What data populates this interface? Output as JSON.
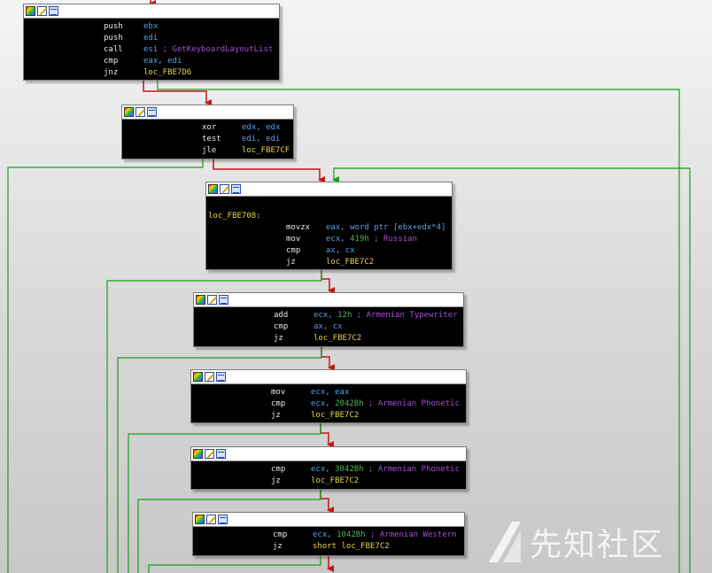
{
  "watermark": {
    "text": "先知社区"
  },
  "nodes": [
    {
      "id": "n1",
      "lines": [
        {
          "m": "push",
          "ops": [
            {
              "t": "ebx",
              "c": "op"
            }
          ]
        },
        {
          "m": "push",
          "ops": [
            {
              "t": "edi",
              "c": "op"
            }
          ]
        },
        {
          "m": "call",
          "ops": [
            {
              "t": "esi",
              "c": "op"
            },
            {
              "t": " ; GetKeyboardLayoutList",
              "c": "cmt"
            }
          ]
        },
        {
          "m": "cmp",
          "ops": [
            {
              "t": "eax",
              "c": "op"
            },
            {
              "t": ", ",
              "c": "sep"
            },
            {
              "t": "edi",
              "c": "op"
            }
          ]
        },
        {
          "m": "jnz",
          "ops": [
            {
              "t": "loc_FBE7D6",
              "c": "tgt"
            }
          ]
        }
      ]
    },
    {
      "id": "n2",
      "lines": [
        {
          "m": "xor",
          "ops": [
            {
              "t": "edx",
              "c": "op"
            },
            {
              "t": ", ",
              "c": "sep"
            },
            {
              "t": "edx",
              "c": "op"
            }
          ]
        },
        {
          "m": "test",
          "ops": [
            {
              "t": "edi",
              "c": "op"
            },
            {
              "t": ", ",
              "c": "sep"
            },
            {
              "t": "edi",
              "c": "op"
            }
          ]
        },
        {
          "m": "jle",
          "ops": [
            {
              "t": "loc_FBE7CF",
              "c": "tgt"
            }
          ]
        }
      ]
    },
    {
      "id": "n3",
      "label": "loc_FBE708:",
      "lines": [
        {
          "m": "movzx",
          "ops": [
            {
              "t": "eax",
              "c": "op"
            },
            {
              "t": ", ",
              "c": "sep"
            },
            {
              "t": "word ptr [ebx+edx*4]",
              "c": "op"
            }
          ]
        },
        {
          "m": "mov",
          "ops": [
            {
              "t": "ecx",
              "c": "op"
            },
            {
              "t": ", ",
              "c": "sep"
            },
            {
              "t": "419h",
              "c": "num"
            },
            {
              "t": " ; Russian",
              "c": "cmt"
            }
          ]
        },
        {
          "m": "cmp",
          "ops": [
            {
              "t": "ax",
              "c": "op"
            },
            {
              "t": ", ",
              "c": "sep"
            },
            {
              "t": "cx",
              "c": "op"
            }
          ]
        },
        {
          "m": "jz",
          "ops": [
            {
              "t": "loc_FBE7C2",
              "c": "tgt"
            }
          ]
        }
      ]
    },
    {
      "id": "n4",
      "lines": [
        {
          "m": "add",
          "ops": [
            {
              "t": "ecx",
              "c": "op"
            },
            {
              "t": ", ",
              "c": "sep"
            },
            {
              "t": "12h",
              "c": "num"
            },
            {
              "t": " ; Armenian Typewriter",
              "c": "cmt"
            }
          ]
        },
        {
          "m": "cmp",
          "ops": [
            {
              "t": "ax",
              "c": "op"
            },
            {
              "t": ", ",
              "c": "sep"
            },
            {
              "t": "cx",
              "c": "op"
            }
          ]
        },
        {
          "m": "jz",
          "ops": [
            {
              "t": "loc_FBE7C2",
              "c": "tgt"
            }
          ]
        }
      ]
    },
    {
      "id": "n5",
      "lines": [
        {
          "m": "mov",
          "ops": [
            {
              "t": "ecx",
              "c": "op"
            },
            {
              "t": ", ",
              "c": "sep"
            },
            {
              "t": "eax",
              "c": "op"
            }
          ]
        },
        {
          "m": "cmp",
          "ops": [
            {
              "t": "ecx",
              "c": "op"
            },
            {
              "t": ", ",
              "c": "sep"
            },
            {
              "t": "2042Bh",
              "c": "num"
            },
            {
              "t": " ; Armenian Phonetic",
              "c": "cmt"
            }
          ]
        },
        {
          "m": "jz",
          "ops": [
            {
              "t": "loc_FBE7C2",
              "c": "tgt"
            }
          ]
        }
      ]
    },
    {
      "id": "n6",
      "lines": [
        {
          "m": "cmp",
          "ops": [
            {
              "t": "ecx",
              "c": "op"
            },
            {
              "t": ", ",
              "c": "sep"
            },
            {
              "t": "3042Bh",
              "c": "num"
            },
            {
              "t": " ; Armenian Phonetic",
              "c": "cmt"
            }
          ]
        },
        {
          "m": "jz",
          "ops": [
            {
              "t": "loc_FBE7C2",
              "c": "tgt"
            }
          ]
        }
      ]
    },
    {
      "id": "n7",
      "lines": [
        {
          "m": "cmp",
          "ops": [
            {
              "t": "ecx",
              "c": "op"
            },
            {
              "t": ", ",
              "c": "sep"
            },
            {
              "t": "1042Bh",
              "c": "num"
            },
            {
              "t": " ; Armenian Western",
              "c": "cmt"
            }
          ]
        },
        {
          "m": "jz",
          "ops": [
            {
              "t": "short loc_FBE7C2",
              "c": "tgt"
            }
          ]
        }
      ]
    }
  ]
}
